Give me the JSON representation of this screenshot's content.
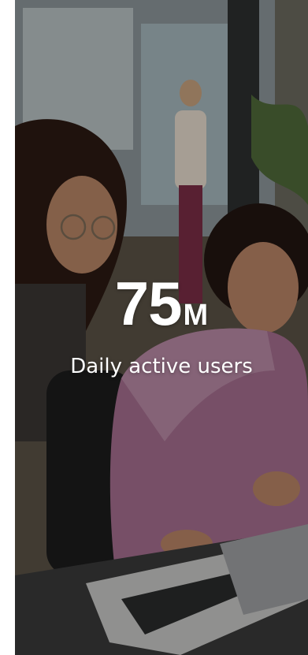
{
  "stat": {
    "value": "75",
    "unit": "M",
    "label": "Daily active users"
  },
  "photo": {
    "icon": "office-team-photo"
  },
  "colors": {
    "text": "#ffffff",
    "overlay": "rgba(0,0,0,0.28)"
  }
}
